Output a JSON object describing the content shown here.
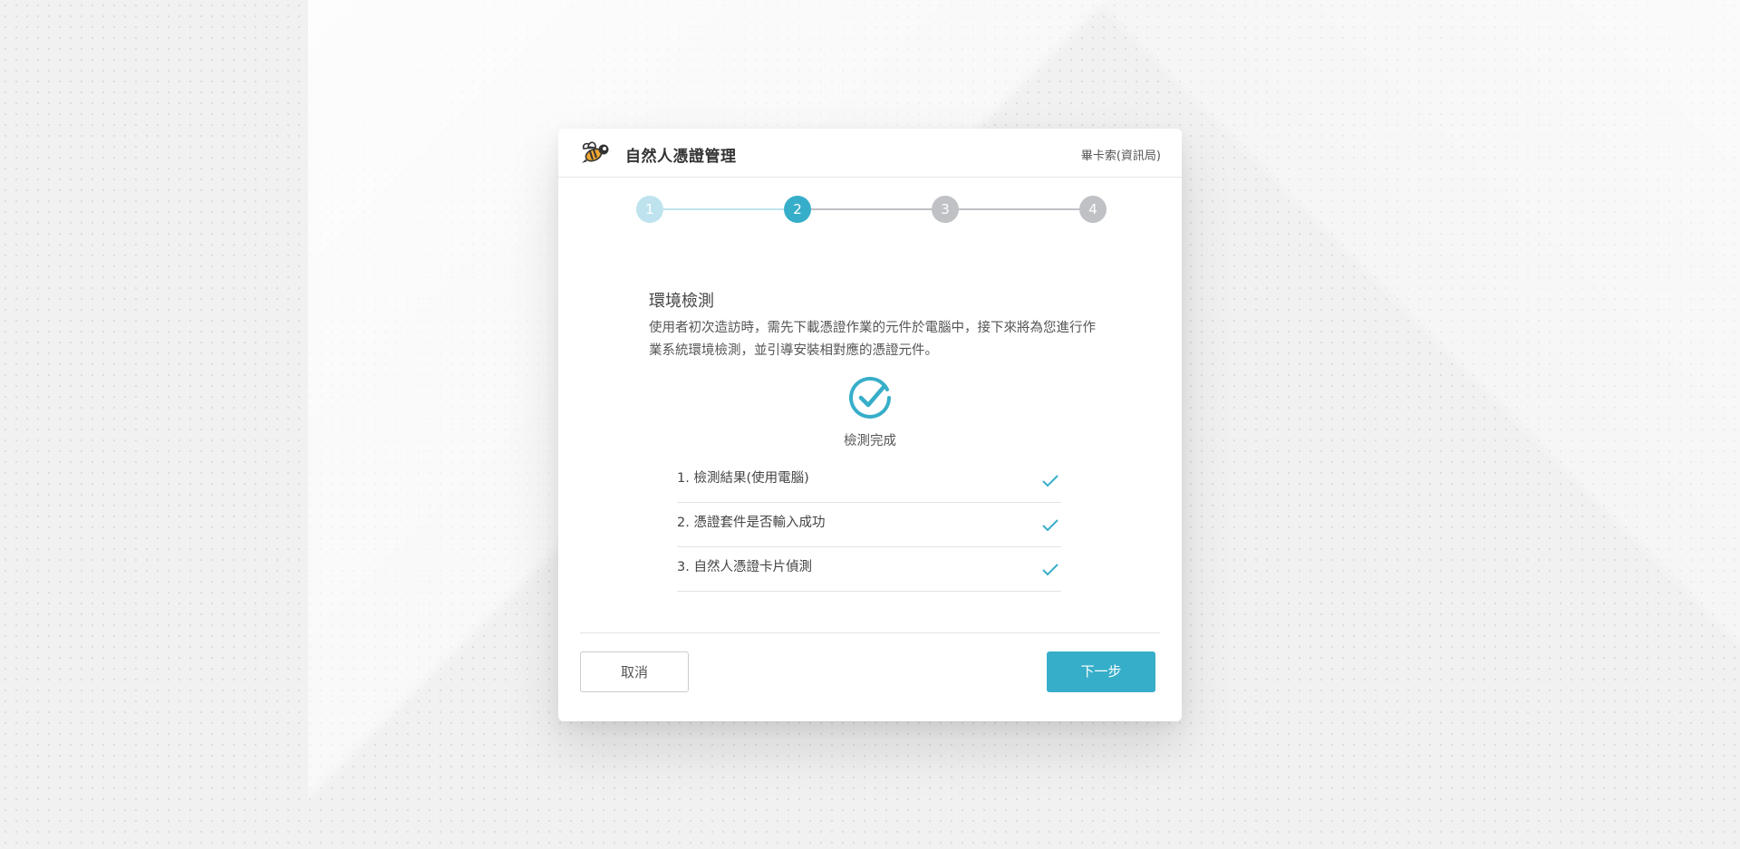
{
  "header": {
    "app_title": "自然人憑證管理",
    "user_label": "畢卡索(資訊局)",
    "logo_icon": "bee-icon"
  },
  "stepper": {
    "steps": [
      {
        "label": "1",
        "state": "done"
      },
      {
        "label": "2",
        "state": "active"
      },
      {
        "label": "3",
        "state": "pending"
      },
      {
        "label": "4",
        "state": "pending"
      }
    ],
    "current_step": 2,
    "colors": {
      "done": "#bfe3ee",
      "active": "#37aec9",
      "pending": "#bfc1c5"
    }
  },
  "content": {
    "title": "環境檢測",
    "description": "使用者初次造訪時，需先下載憑證作業的元件於電腦中，接下來將為您進行作業系統環境檢測，並引導安裝相對應的憑證元件。",
    "status_icon": "check-circle-icon",
    "status_text": "檢測完成",
    "checks": [
      {
        "text": "1. 檢測結果(使用電腦)",
        "status": "passed",
        "icon": "check-icon"
      },
      {
        "text": "2. 憑證套件是否輸入成功",
        "status": "passed",
        "icon": "check-icon"
      },
      {
        "text": "3. 自然人憑證卡片偵測",
        "status": "passed",
        "icon": "check-icon"
      }
    ]
  },
  "footer": {
    "cancel_label": "取消",
    "next_label": "下一步"
  },
  "colors": {
    "accent": "#37aec9",
    "text": "#444444"
  }
}
